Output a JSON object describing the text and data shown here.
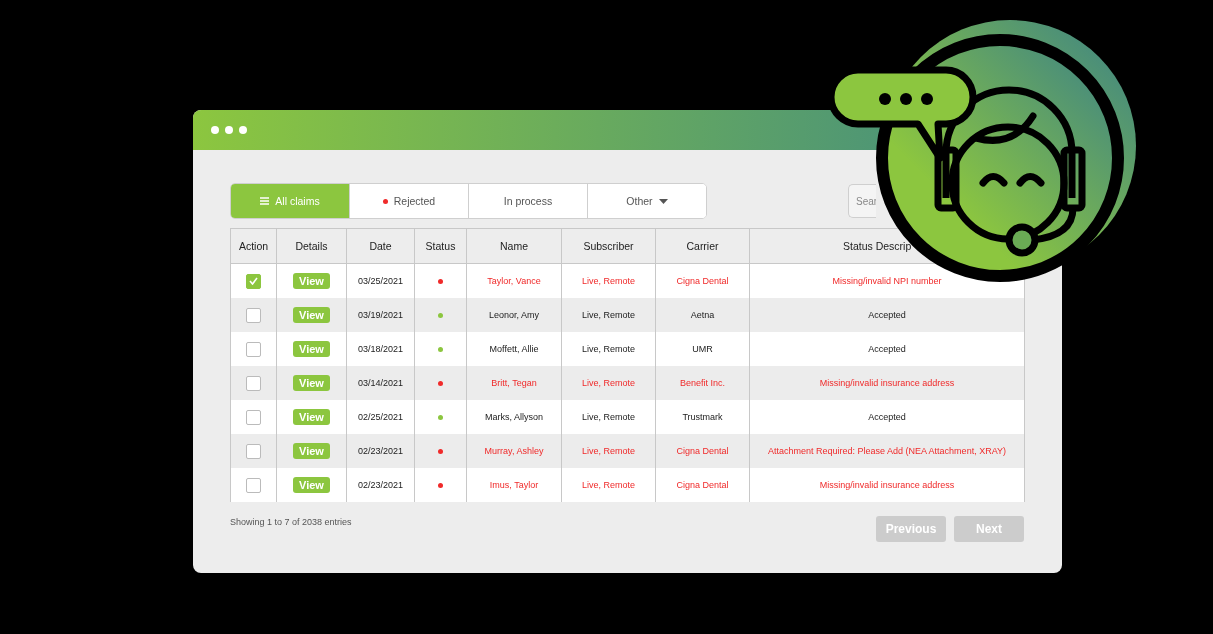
{
  "tabs": [
    {
      "label": "All claims",
      "kind": "list",
      "selected": true
    },
    {
      "label": "Rejected",
      "kind": "dot",
      "selected": false
    },
    {
      "label": "In process",
      "kind": "plain",
      "selected": false
    },
    {
      "label": "Other",
      "kind": "dropdown",
      "selected": false
    }
  ],
  "search": {
    "placeholder": "Sear"
  },
  "table": {
    "columns": [
      "Action",
      "Details",
      "Date",
      "Status",
      "Name",
      "Subscriber",
      "Carrier",
      "Status Descrip"
    ],
    "rows": [
      {
        "checked": true,
        "details": "View",
        "date": "03/25/2021",
        "color": "#f02a2a",
        "rejected": true,
        "name": "Taylor, Vance",
        "subscriber": "Live, Remote",
        "carrier": "Cigna Dental",
        "description": "Missing/invalid NPI number"
      },
      {
        "checked": false,
        "details": "View",
        "date": "03/19/2021",
        "color": "#8cc63f",
        "rejected": false,
        "name": "Leonor, Amy",
        "subscriber": "Live, Remote",
        "carrier": "Aetna",
        "description": "Accepted"
      },
      {
        "checked": false,
        "details": "View",
        "date": "03/18/2021",
        "color": "#8cc63f",
        "rejected": false,
        "name": "Moffett, Allie",
        "subscriber": "Live, Remote",
        "carrier": "UMR",
        "description": "Accepted"
      },
      {
        "checked": false,
        "details": "View",
        "date": "03/14/2021",
        "color": "#f02a2a",
        "rejected": true,
        "name": "Britt, Tegan",
        "subscriber": "Live, Remote",
        "carrier": "Benefit Inc.",
        "description": "Missing/invalid insurance address"
      },
      {
        "checked": false,
        "details": "View",
        "date": "02/25/2021",
        "color": "#8cc63f",
        "rejected": false,
        "name": "Marks, Allyson",
        "subscriber": "Live, Remote",
        "carrier": "Trustmark",
        "description": "Accepted"
      },
      {
        "checked": false,
        "details": "View",
        "date": "02/23/2021",
        "color": "#f02a2a",
        "rejected": true,
        "name": "Murray, Ashley",
        "subscriber": "Live, Remote",
        "carrier": "Cigna Dental",
        "description": "Attachment Required: Please Add (NEA Attachment, XRAY)"
      },
      {
        "checked": false,
        "details": "View",
        "date": "02/23/2021",
        "color": "#f02a2a",
        "rejected": true,
        "name": "Imus, Taylor",
        "subscriber": "Live, Remote",
        "carrier": "Cigna Dental",
        "description": "Missing/invalid insurance address"
      }
    ]
  },
  "footer": {
    "summary": "Showing 1 to 7 of 2038 entries"
  },
  "pagination": [
    {
      "label": "Previous",
      "disabled": true
    },
    {
      "label": "Next",
      "disabled": true
    }
  ]
}
